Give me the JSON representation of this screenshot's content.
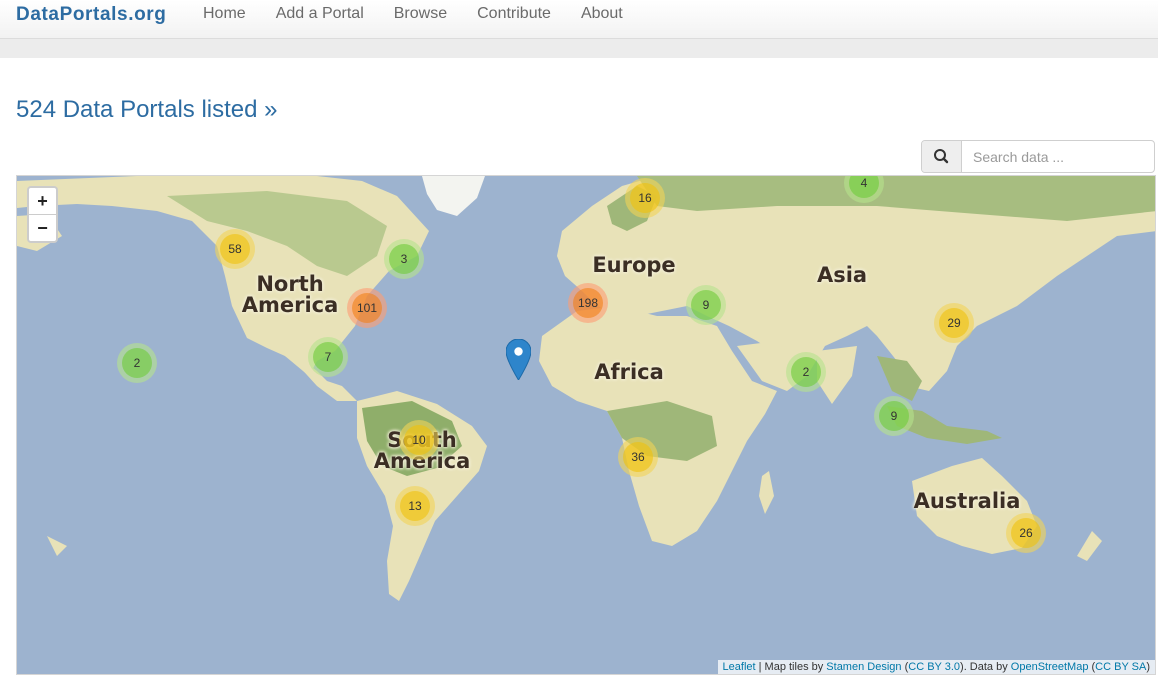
{
  "navbar": {
    "brand": "DataPortals.org",
    "items": [
      "Home",
      "Add a Portal",
      "Browse",
      "Contribute",
      "About"
    ]
  },
  "heading": "524 Data Portals listed »",
  "search": {
    "placeholder": "Search data ..."
  },
  "map": {
    "zoom_in": "+",
    "zoom_out": "−",
    "regions": {
      "north_america": "North\nAmerica",
      "south_america": "South\nAmerica",
      "europe": "Europe",
      "asia": "Asia",
      "africa": "Africa",
      "australia": "Australia"
    },
    "clusters": [
      {
        "label": "58",
        "size": "medium"
      },
      {
        "label": "3",
        "size": "small"
      },
      {
        "label": "101",
        "size": "large"
      },
      {
        "label": "7",
        "size": "small"
      },
      {
        "label": "2",
        "size": "small"
      },
      {
        "label": "16",
        "size": "medium"
      },
      {
        "label": "4",
        "size": "small"
      },
      {
        "label": "198",
        "size": "large"
      },
      {
        "label": "9",
        "size": "small"
      },
      {
        "label": "29",
        "size": "medium"
      },
      {
        "label": "2",
        "size": "small"
      },
      {
        "label": "9",
        "size": "small"
      },
      {
        "label": "10",
        "size": "medium"
      },
      {
        "label": "36",
        "size": "medium"
      },
      {
        "label": "13",
        "size": "medium"
      },
      {
        "label": "26",
        "size": "medium"
      }
    ],
    "attribution": {
      "leaflet": "Leaflet",
      "tiles_prefix": " | Map tiles by ",
      "stamen": "Stamen Design",
      "open1": " (",
      "ccby": "CC BY 3.0",
      "mid": "). Data by ",
      "osm": "OpenStreetMap",
      "open2": " (",
      "ccbysa": "CC BY SA",
      "close": ")"
    }
  },
  "colors": {
    "brand": "#2d6ca2",
    "water": "#9db3cf",
    "land": "#e8e2b8",
    "forest": "#9fb779"
  }
}
